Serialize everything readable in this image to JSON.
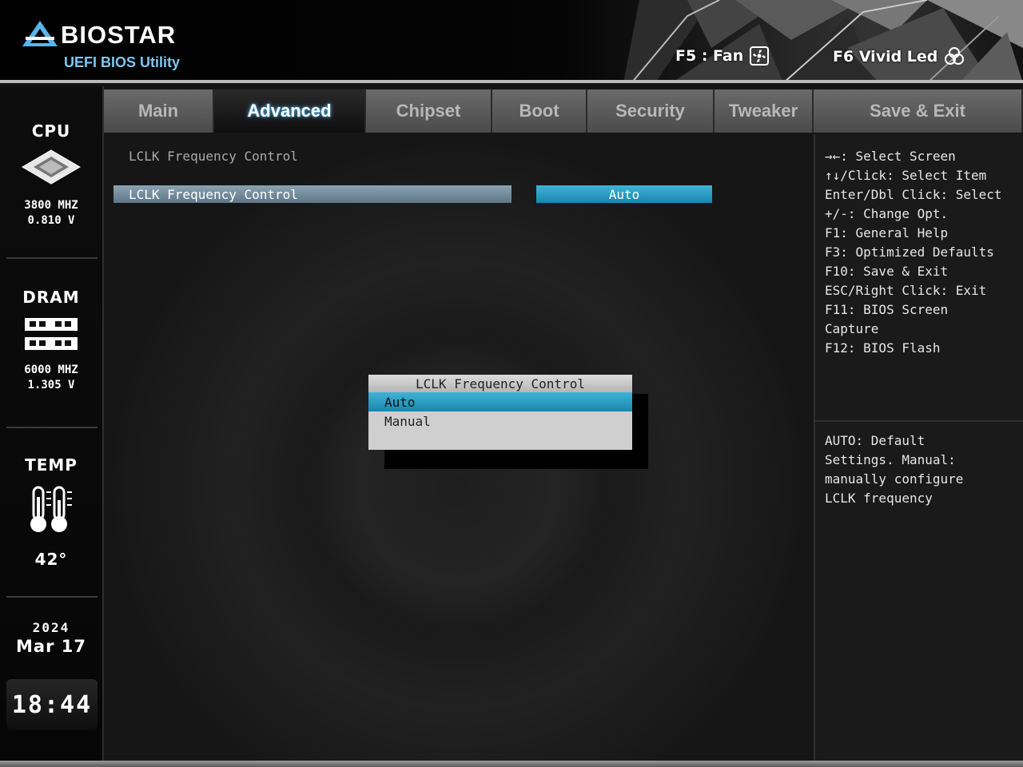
{
  "header": {
    "brand": "BIOSTAR",
    "subtitle": "UEFI BIOS Utility",
    "hotkeys": [
      {
        "key_label": "F5 : Fan",
        "icon": "fan-icon"
      },
      {
        "key_label": "F6 Vivid Led",
        "icon": "led-icon"
      }
    ]
  },
  "sidebar": {
    "cpu": {
      "title": "CPU",
      "freq": "3800 MHZ",
      "volt": "0.810 V"
    },
    "dram": {
      "title": "DRAM",
      "freq": "6000 MHZ",
      "volt": "1.305 V"
    },
    "temp": {
      "title": "TEMP",
      "value": "42°"
    },
    "date": {
      "year": "2024",
      "month_day": "Mar 17"
    },
    "time": "18:44"
  },
  "tabs": [
    {
      "label": "Main",
      "active": false
    },
    {
      "label": "Advanced",
      "active": true
    },
    {
      "label": "Chipset",
      "active": false
    },
    {
      "label": "Boot",
      "active": false
    },
    {
      "label": "Security",
      "active": false
    },
    {
      "label": "Tweaker",
      "active": false
    },
    {
      "label": "Save & Exit",
      "active": false
    }
  ],
  "main": {
    "section_title": "LCLK Frequency Control",
    "item": {
      "label": "LCLK Frequency Control",
      "value": "Auto"
    },
    "popup": {
      "title": "LCLK Frequency Control",
      "options": [
        "Auto",
        "Manual"
      ],
      "selected": "Auto"
    }
  },
  "help": {
    "keys": [
      "→←: Select Screen",
      "↑↓/Click: Select Item",
      "Enter/Dbl Click: Select",
      "+/-: Change Opt.",
      "F1: General Help",
      "F3: Optimized Defaults",
      "F10: Save & Exit",
      "ESC/Right Click: Exit",
      "F11: BIOS Screen",
      "Capture",
      "F12: BIOS Flash"
    ],
    "description": [
      "AUTO: Default",
      "Settings. Manual:",
      "manually configure",
      "LCLK frequency"
    ]
  },
  "colors": {
    "accent": "#2aa3cc",
    "brand_blue": "#7fc6f0",
    "panel_bg": "#1a1a1a"
  }
}
